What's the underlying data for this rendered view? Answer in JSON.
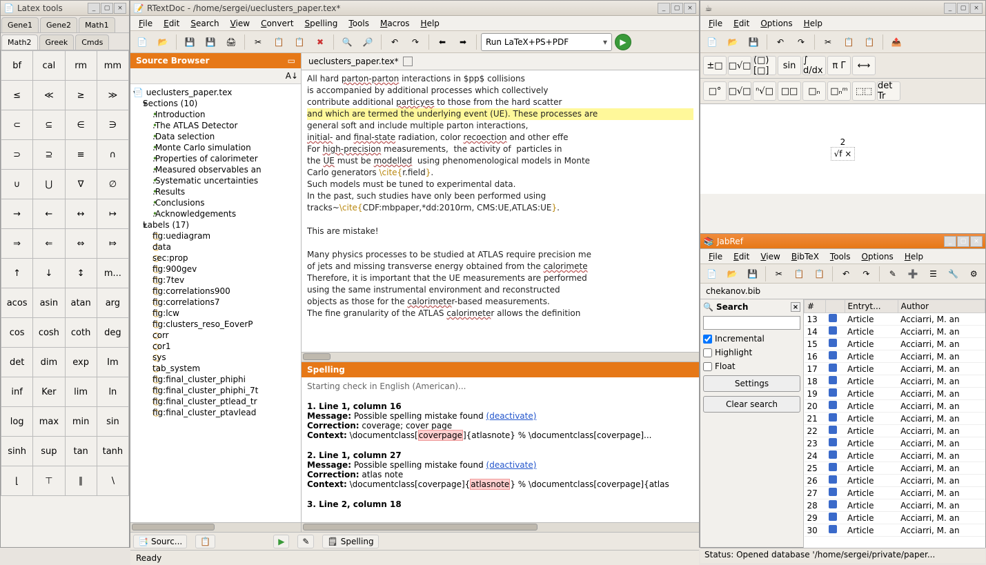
{
  "latextools": {
    "title": "Latex tools",
    "tabs_row1": [
      "Gene1",
      "Gene2",
      "Math1"
    ],
    "tabs_row2": [
      "Math2",
      "Greek",
      "Cmds"
    ],
    "active_tab": "Math2",
    "cells": [
      "bf",
      "cal",
      "rm",
      "mm",
      "≤",
      "≪",
      "≥",
      "≫",
      "⊂",
      "⊆",
      "∈",
      "∋",
      "⊃",
      "⊇",
      "≡",
      "∩",
      "∪",
      "⋃",
      "∇",
      "∅",
      "→",
      "←",
      "↔",
      "↦",
      "⇒",
      "⇐",
      "⇔",
      "⤇",
      "↑",
      "↓",
      "↕",
      "m...",
      "acos",
      "asin",
      "atan",
      "arg",
      "cos",
      "cosh",
      "coth",
      "deg",
      "det",
      "dim",
      "exp",
      "Im",
      "inf",
      "Ker",
      "lim",
      "ln",
      "log",
      "max",
      "min",
      "sin",
      "sinh",
      "sup",
      "tan",
      "tanh",
      "⌊",
      "⊤",
      "∥",
      "∖"
    ]
  },
  "rtextdoc": {
    "title": "RTextDoc - /home/sergei/ueclusters_paper.tex*",
    "menus": [
      "File",
      "Edit",
      "Search",
      "View",
      "Convert",
      "Spelling",
      "Tools",
      "Macros",
      "Help"
    ],
    "run_combo": "Run LaTeX+PS+PDF",
    "source_browser": {
      "title": "Source Browser",
      "root": "ueclusters_paper.tex",
      "sections_label": "Sections (10)",
      "sections": [
        ".Introduction",
        ".The ATLAS Detector",
        ".Data selection",
        ".Monte Carlo simulation",
        ".Properties of calorimeter",
        ".Measured observables an",
        ".Systematic uncertainties",
        ".Results",
        ".Conclusions",
        ".Acknowledgements"
      ],
      "labels_label": "Labels (17)",
      "labels": [
        "fig:uediagram",
        "data",
        "sec:prop",
        "fig:900gev",
        "fig:7tev",
        "fig:correlations900",
        "fig:correlations7",
        "fig:lcw",
        "fig:clusters_reso_EoverP",
        "corr",
        "cor1",
        "sys",
        "tab_system",
        "fig:final_cluster_phiphi",
        "fig:final_cluster_phiphi_7t",
        "fig:final_cluster_ptlead_tr",
        "fig:final_cluster_ptavlead"
      ]
    },
    "editor_tab": "ueclusters_paper.tex*",
    "code_lines": [
      "All hard parton-parton interactions in $pp$ collisions",
      "is accompanied by additional processes which collectively",
      "contribute additional particyes to those from the hard scatter",
      "and which are termed the underlying event (UE). These processes are",
      "general soft and include multiple parton interactions,",
      "initial- and final-state radiation, color recoection and other effe",
      "For high-precision measurements,  the activity of  particles in",
      "the UE must be modelled  using phenomenological models in Monte",
      "Carlo generators \\cite{r.field}.",
      "Such models must be tuned to experimental data.",
      "In the past, such studies have only been performed using",
      "tracks~\\cite{CDF:mbpaper,*dd:2010rm, CMS:UE,ATLAS:UE}.",
      "",
      "This are mistake!",
      "",
      "Many physics processes to be studied at ATLAS require precision me",
      "of jets and missing transverse energy obtained from the calorimete",
      "Therefore, it is important that the UE measurements are performed",
      "using the same instrumental environment and reconstructed",
      "objects as those for the calorimeter-based measurements.",
      "The fine granularity of the ATLAS calorimeter allows the definition"
    ],
    "spelling": {
      "title": "Spelling",
      "starting": "Starting check in English (American)...",
      "items": [
        {
          "loc": "1. Line 1, column 16",
          "msg_label": "Message:",
          "msg": "Possible spelling mistake found",
          "deact": "(deactivate)",
          "corr_label": "Correction:",
          "corr": "coverage; cover page",
          "ctx_label": "Context:",
          "ctx_pre": "\\documentclass[",
          "ctx_mark": "coverpage",
          "ctx_post": "]{atlasnote} % \\documentclass[coverpage]..."
        },
        {
          "loc": "2. Line 1, column 27",
          "msg_label": "Message:",
          "msg": "Possible spelling mistake found",
          "deact": "(deactivate)",
          "corr_label": "Correction:",
          "corr": "atlas note",
          "ctx_label": "Context:",
          "ctx_pre": "\\documentclass[coverpage]{",
          "ctx_mark": "atlasnote",
          "ctx_post": "} % \\documentclass[coverpage]{atlas"
        },
        {
          "loc": "3. Line 2, column 18"
        }
      ]
    },
    "bottom_tabs": [
      "Sourc...",
      "",
      "Spelling"
    ],
    "status": "Ready"
  },
  "formula": {
    "menus": [
      "File",
      "Edit",
      "Options",
      "Help"
    ],
    "row2": [
      "±□",
      "□√□",
      "(□)[□]",
      "sin",
      "∫ d/dx",
      "π Γ",
      "⟷"
    ],
    "row3": [
      "□°",
      "□√□",
      "ⁿ√□",
      "□□",
      "□ₙ",
      "□ₙᵐ",
      "⬚⬚",
      "det Tr"
    ],
    "canvas_top": "2",
    "canvas_bot": "√f ×"
  },
  "jabref": {
    "title": "JabRef",
    "menus": [
      "File",
      "Edit",
      "View",
      "BibTeX",
      "Tools",
      "Options",
      "Help"
    ],
    "bibfile": "chekanov.bib",
    "search": {
      "label": "Search",
      "incremental": "Incremental",
      "highlight": "Highlight",
      "float": "Float",
      "settings": "Settings",
      "clear": "Clear search"
    },
    "columns": [
      "#",
      "",
      "Entryt...",
      "Author"
    ],
    "rows": [
      {
        "n": "13",
        "t": "Article",
        "a": "Acciarri, M. an"
      },
      {
        "n": "14",
        "t": "Article",
        "a": "Acciarri, M. an"
      },
      {
        "n": "15",
        "t": "Article",
        "a": "Acciarri, M. an"
      },
      {
        "n": "16",
        "t": "Article",
        "a": "Acciarri, M. an"
      },
      {
        "n": "17",
        "t": "Article",
        "a": "Acciarri, M. an"
      },
      {
        "n": "18",
        "t": "Article",
        "a": "Acciarri, M. an"
      },
      {
        "n": "19",
        "t": "Article",
        "a": "Acciarri, M. an"
      },
      {
        "n": "20",
        "t": "Article",
        "a": "Acciarri, M. an"
      },
      {
        "n": "21",
        "t": "Article",
        "a": "Acciarri, M. an"
      },
      {
        "n": "22",
        "t": "Article",
        "a": "Acciarri, M. an"
      },
      {
        "n": "23",
        "t": "Article",
        "a": "Acciarri, M. an"
      },
      {
        "n": "24",
        "t": "Article",
        "a": "Acciarri, M. an"
      },
      {
        "n": "25",
        "t": "Article",
        "a": "Acciarri, M. an"
      },
      {
        "n": "26",
        "t": "Article",
        "a": "Acciarri, M. an"
      },
      {
        "n": "27",
        "t": "Article",
        "a": "Acciarri, M. an"
      },
      {
        "n": "28",
        "t": "Article",
        "a": "Acciarri, M. an"
      },
      {
        "n": "29",
        "t": "Article",
        "a": "Acciarri, M. an"
      },
      {
        "n": "30",
        "t": "Article",
        "a": "Acciarri, M. an"
      }
    ],
    "status": "Status: Opened database '/home/sergei/private/paper..."
  }
}
